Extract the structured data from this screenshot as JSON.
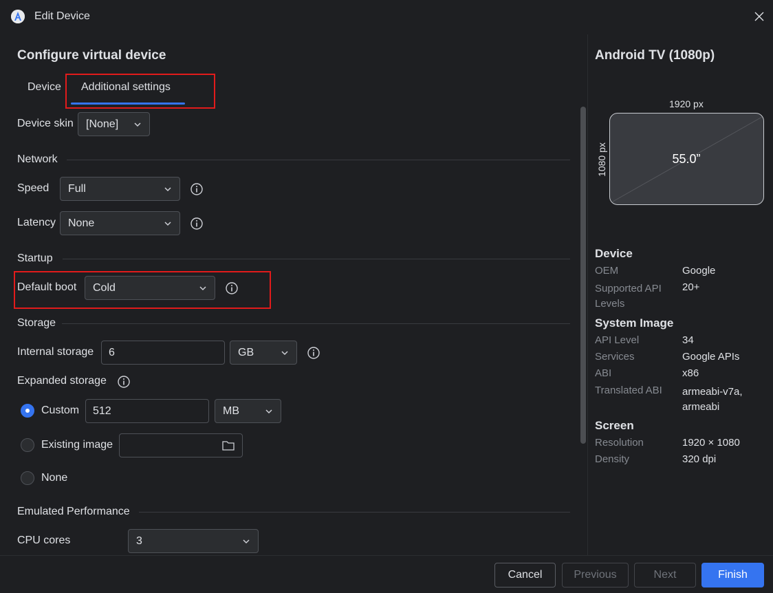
{
  "window": {
    "title": "Edit Device"
  },
  "main": {
    "heading": "Configure virtual device",
    "tabs": [
      {
        "label": "Device"
      },
      {
        "label": "Additional settings"
      }
    ],
    "device_skin": {
      "label": "Device skin",
      "value": "[None]"
    },
    "network": {
      "section": "Network",
      "speed": {
        "label": "Speed",
        "value": "Full"
      },
      "latency": {
        "label": "Latency",
        "value": "None"
      }
    },
    "startup": {
      "section": "Startup",
      "default_boot": {
        "label": "Default boot",
        "value": "Cold"
      }
    },
    "storage": {
      "section": "Storage",
      "internal": {
        "label": "Internal storage",
        "value": "6",
        "unit": "GB"
      },
      "expanded": {
        "label": "Expanded storage",
        "options": [
          {
            "label": "Custom",
            "selected": true
          },
          {
            "label": "Existing image",
            "selected": false
          },
          {
            "label": "None",
            "selected": false
          }
        ],
        "custom_value": "512",
        "custom_unit": "MB",
        "existing_image_path": ""
      }
    },
    "performance": {
      "section": "Emulated Performance",
      "cpu_cores": {
        "label": "CPU cores",
        "value": "3"
      }
    }
  },
  "preview": {
    "title": "Android TV (1080p)",
    "width_label": "1920 px",
    "height_label": "1080 px",
    "diagonal": "55.0”"
  },
  "details": {
    "device": {
      "heading": "Device",
      "rows": [
        {
          "key": "OEM",
          "value": "Google"
        },
        {
          "key": "Supported API Levels",
          "value": "20+"
        }
      ]
    },
    "system_image": {
      "heading": "System Image",
      "rows": [
        {
          "key": "API Level",
          "value": "34"
        },
        {
          "key": "Services",
          "value": "Google APIs"
        },
        {
          "key": "ABI",
          "value": "x86"
        },
        {
          "key": "Translated ABI",
          "value": "armeabi-v7a, armeabi"
        }
      ]
    },
    "screen": {
      "heading": "Screen",
      "rows": [
        {
          "key": "Resolution",
          "value": "1920 × 1080"
        },
        {
          "key": "Density",
          "value": "320 dpi"
        }
      ]
    }
  },
  "footer": {
    "cancel": "Cancel",
    "previous": "Previous",
    "next": "Next",
    "finish": "Finish"
  },
  "colors": {
    "accent": "#3574f0",
    "highlight_border": "#e21b1b",
    "background": "#1e1f22"
  }
}
